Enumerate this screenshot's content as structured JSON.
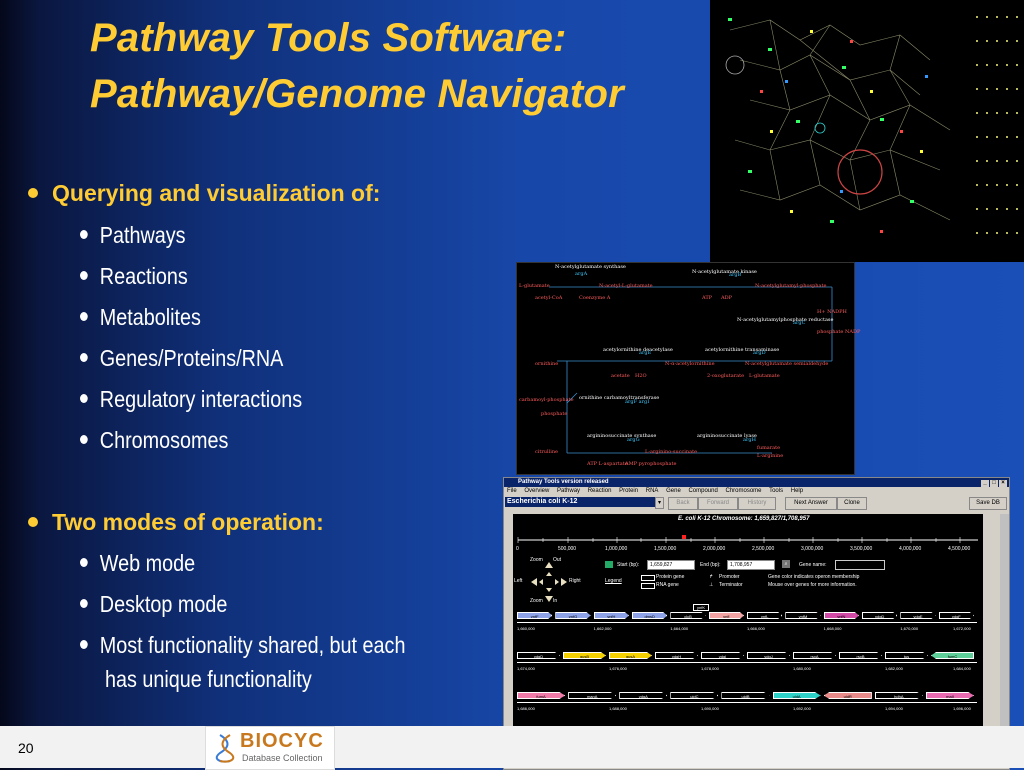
{
  "slide": {
    "title_line1": "Pathway Tools Software:",
    "title_line2": "Pathway/Genome Navigator",
    "page_number": "20"
  },
  "bullets": {
    "query_heading": "Querying and visualization of:",
    "query_items": [
      "Pathways",
      "Reactions",
      "Metabolites",
      "Genes/Proteins/RNA",
      "Regulatory interactions",
      "Chromosomes"
    ],
    "modes_heading": "Two modes of operation:",
    "modes_items": [
      "Web mode",
      "Desktop mode",
      "Most functionality shared, but each"
    ],
    "modes_item3_cont": "has unique functionality"
  },
  "logo": {
    "name": "BIOCYC",
    "tagline": "Database Collection"
  },
  "pathway": {
    "labels": [
      "N-acetylglutamate synthase",
      "argA",
      "N-acetylglutamate kinase",
      "argB",
      "L-glutamate",
      "N-acetyl-L-glutamate",
      "N-acetylglutamyl-phosphate",
      "acetyl-CoA",
      "Coenzyme A",
      "ATP",
      "ADP",
      "H+ NADPH",
      "N-acetylglutamylphosphate reductase",
      "argC",
      "phosphate NADP",
      "acetylornithine deacetylase",
      "argE",
      "acetylornithine transaminase",
      "argD",
      "ornithine",
      "N-α-acetylornithine",
      "N-acetylglutamate semialdehyde",
      "acetate",
      "H2O",
      "2-oxoglutarate",
      "L-glutamate",
      "ornithine carbamoyltransferase",
      "argF argI",
      "carbamoyl-phosphate",
      "phosphate",
      "argininosuccinate synthase",
      "argG",
      "argininosuccinate lyase",
      "argH",
      "citrulline",
      "L-arginino-succinate",
      "fumarate",
      "L-arginine",
      "ATP L-aspartate",
      "AMP pyrophosphate"
    ]
  },
  "app": {
    "window_title": "Pathway Tools version released",
    "window_buttons": [
      "_",
      "□",
      "×"
    ],
    "menu": [
      "File",
      "Overview",
      "Pathway",
      "Reaction",
      "Protein",
      "RNA",
      "Gene",
      "Compound",
      "Chromosome",
      "Tools",
      "Help"
    ],
    "organism": "Escherichia coli K-12",
    "toolbar_buttons": [
      "Back",
      "Forward",
      "History",
      "Next Answer",
      "Clone",
      "Save DB"
    ],
    "chromosome_title": "E. coli K-12 Chromosome: 1,659,827/1,708,957",
    "scale_ticks": [
      "0",
      "500,000",
      "1,000,000",
      "1,500,000",
      "2,000,000",
      "2,500,000",
      "3,000,000",
      "3,500,000",
      "4,000,000",
      "4,500,000"
    ],
    "zoom": {
      "zoom_label": "Zoom",
      "out": "Out",
      "in": "In",
      "left": "Left",
      "right": "Right"
    },
    "start_label": "Start (bp):",
    "start_value": "1,659,827",
    "end_label": "End (bp):",
    "end_value": "1,708,957",
    "gene_name_label": "Gene name:",
    "gene_name_value": "",
    "legend": {
      "title": "Legend",
      "protein_gene": "Protein gene",
      "rna_gene": "RNA gene",
      "promoter": "Promoter",
      "terminator": "Terminator",
      "note1": "Gene color indicates operon membership",
      "note2": "Mouse over genes for more information."
    },
    "rows": [
      {
        "genes": [
          {
            "name": "ynfF",
            "color": "#8ea2e8",
            "dir": "r"
          },
          {
            "name": "ynfG",
            "color": "#8ea2e8",
            "dir": "r"
          },
          {
            "name": "ynfH",
            "color": "#8ea2e8",
            "dir": "r"
          },
          {
            "name": "dmsD",
            "color": "#8ea2e8",
            "dir": "r"
          },
          {
            "name": "clcB",
            "color": "#000000",
            "dir": "r"
          },
          {
            "name": "ynfI",
            "color": "#f2a3a3",
            "dir": "r"
          },
          {
            "name": "ynfL",
            "color": "#000000",
            "dir": "r"
          },
          {
            "name": "ynfM",
            "color": "#000000",
            "dir": "r"
          },
          {
            "name": "ynfN",
            "color": "#d14aa6",
            "dir": "r"
          },
          {
            "name": "ydgD",
            "color": "#000000",
            "dir": "r"
          },
          {
            "name": "ydgE",
            "color": "#000000",
            "dir": "r"
          },
          {
            "name": "ydgF",
            "color": "#000000",
            "dir": "r"
          }
        ],
        "ticks": [
          "1,660,000",
          "1,662,000",
          "1,664,000",
          "1,666,000",
          "1,668,000",
          "1,670,000",
          "1,672,000"
        ],
        "extra_label": "ynfK"
      },
      {
        "genes": [
          {
            "name": "ydgD",
            "color": "#000000",
            "dir": "r"
          },
          {
            "name": "gusB",
            "color": "#f5d000",
            "dir": "r"
          },
          {
            "name": "gusA",
            "color": "#f5d000",
            "dir": "r"
          },
          {
            "name": "ydgH",
            "color": "#000000",
            "dir": "r"
          },
          {
            "name": "ydgI",
            "color": "#000000",
            "dir": "r"
          },
          {
            "name": "ydgJ",
            "color": "#000000",
            "dir": "r"
          },
          {
            "name": "rsxA",
            "color": "#000000",
            "dir": "r"
          },
          {
            "name": "rsxB",
            "color": "#000000",
            "dir": "r"
          },
          {
            "name": "tus",
            "color": "#000000",
            "dir": "r"
          },
          {
            "name": "fumC",
            "color": "#5fcf9a",
            "dir": "l"
          }
        ],
        "ticks": [
          "1,674,000",
          "1,676,000",
          "1,678,000",
          "1,680,000",
          "1,682,000",
          "1,684,000"
        ]
      },
      {
        "genes": [
          {
            "name": "fumA",
            "color": "#f07aa8",
            "dir": "r"
          },
          {
            "name": "manA",
            "color": "#000000",
            "dir": "r"
          },
          {
            "name": "ydgA",
            "color": "#000000",
            "dir": "r"
          },
          {
            "name": "uidC",
            "color": "#000000",
            "dir": "r"
          },
          {
            "name": "uidB",
            "color": "#000000",
            "dir": "r"
          },
          {
            "name": "uidA",
            "color": "#2ed1c8",
            "dir": "r"
          },
          {
            "name": "uidR",
            "color": "#e88a8a",
            "dir": "l"
          },
          {
            "name": "hdhA",
            "color": "#000000",
            "dir": "r"
          },
          {
            "name": "malI",
            "color": "#e86ab0",
            "dir": "r"
          }
        ],
        "ticks": [
          "1,686,000",
          "1,688,000",
          "1,690,000",
          "1,692,000",
          "1,694,000",
          "1,696,000"
        ]
      },
      {
        "genes": [
          {
            "name": "malI",
            "color": "#e86ab0",
            "dir": "r"
          },
          {
            "name": "malX",
            "color": "#e83a6a",
            "dir": "r"
          },
          {
            "name": "malY",
            "color": "#e83a6a",
            "dir": "r"
          },
          {
            "name": "add",
            "color": "#000000",
            "dir": "r"
          },
          {
            "name": "ydgJ",
            "color": "#000000",
            "dir": "r"
          },
          {
            "name": "ydgK",
            "color": "#000000",
            "dir": "r"
          },
          {
            "name": "rsxA",
            "color": "#000000",
            "dir": "r"
          },
          {
            "name": "rsxB",
            "color": "#000000",
            "dir": "r"
          },
          {
            "name": "rsxC",
            "color": "#000000",
            "dir": "r"
          },
          {
            "name": "rsxD",
            "color": "#000000",
            "dir": "r"
          },
          {
            "name": "rsxG",
            "color": "#000000",
            "dir": "r"
          }
        ],
        "ticks": [
          "1,698,000",
          "1,700,000",
          "1,702,000",
          "1,704,000",
          "1,706,000",
          "1,708,000"
        ]
      }
    ]
  }
}
